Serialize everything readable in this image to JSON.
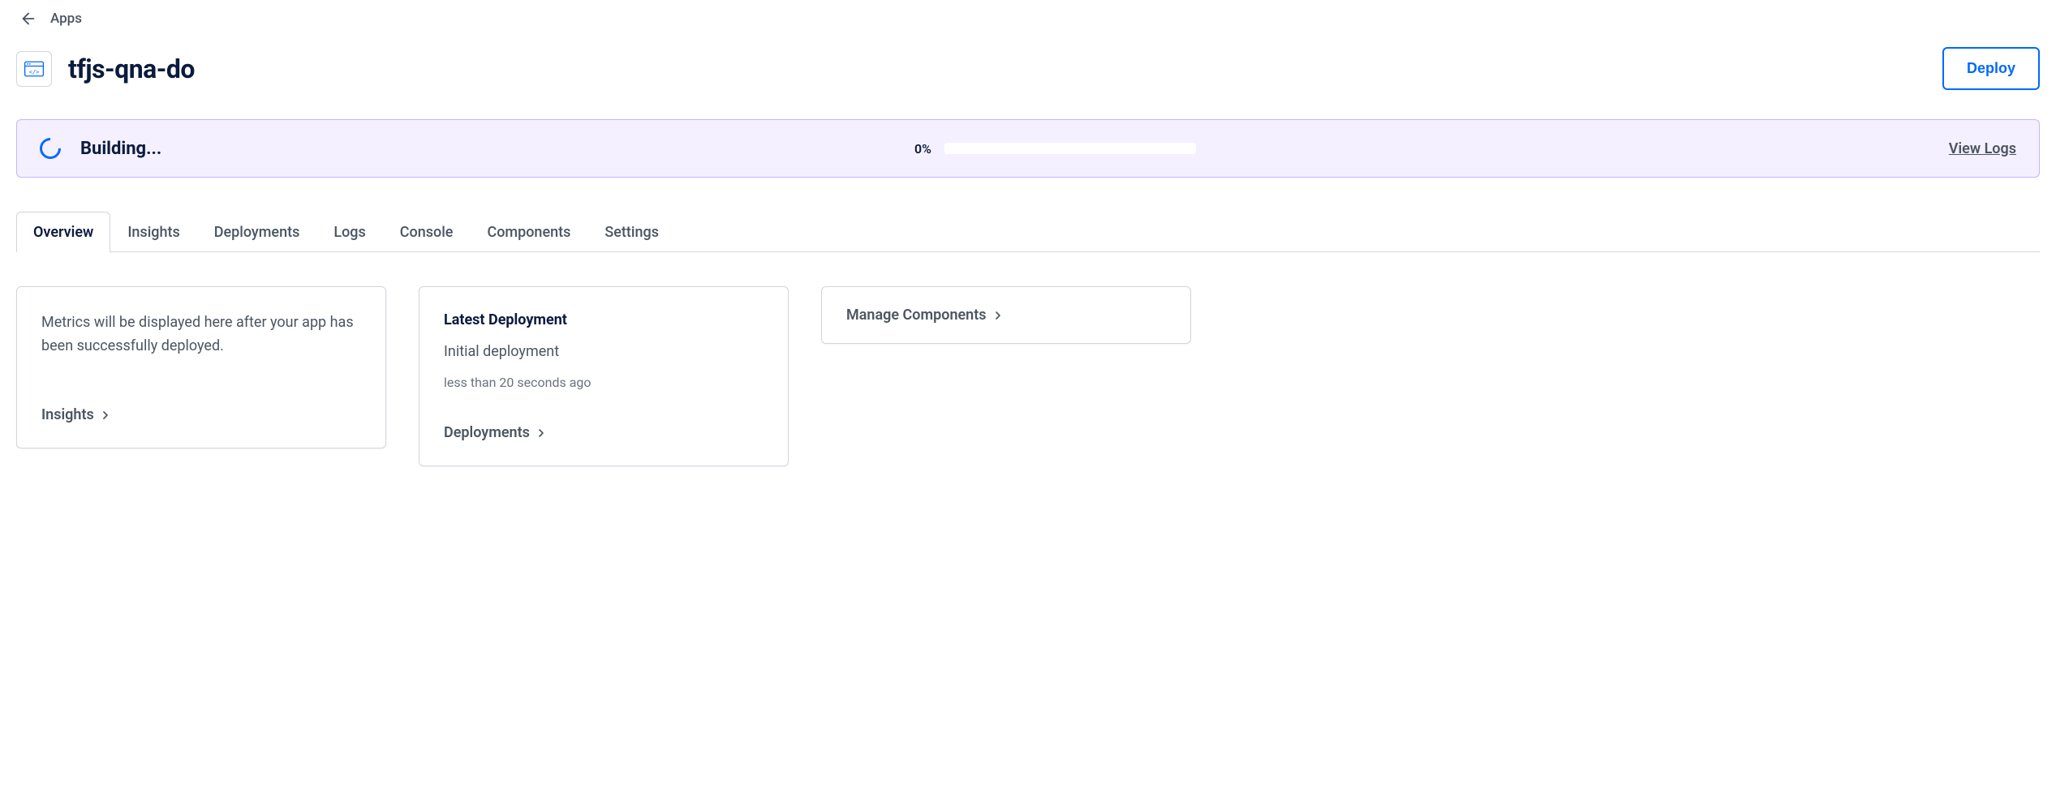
{
  "breadcrumb": {
    "label": "Apps"
  },
  "app": {
    "title": "tfjs-qna-do"
  },
  "actions": {
    "deploy": "Deploy"
  },
  "status": {
    "text": "Building...",
    "percent": "0%",
    "view_logs": "View Logs"
  },
  "tabs": [
    {
      "label": "Overview",
      "active": true
    },
    {
      "label": "Insights",
      "active": false
    },
    {
      "label": "Deployments",
      "active": false
    },
    {
      "label": "Logs",
      "active": false
    },
    {
      "label": "Console",
      "active": false
    },
    {
      "label": "Components",
      "active": false
    },
    {
      "label": "Settings",
      "active": false
    }
  ],
  "cards": {
    "metrics": {
      "text": "Metrics will be displayed here after your app has been successfully deployed.",
      "link": "Insights"
    },
    "deployment": {
      "title": "Latest Deployment",
      "name": "Initial deployment",
      "time": "less than 20 seconds ago",
      "link": "Deployments"
    },
    "components": {
      "link": "Manage Components"
    }
  }
}
